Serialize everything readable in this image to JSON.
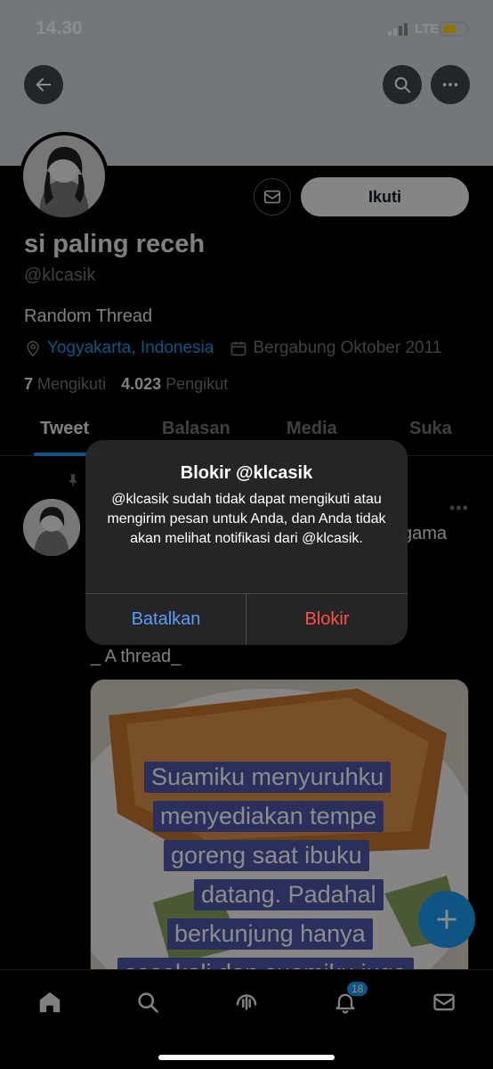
{
  "status_bar": {
    "time": "14.30",
    "network": "LTE"
  },
  "profile": {
    "name": "si paling receh",
    "handle": "@klcasik",
    "bio": "Random Thread",
    "location": "Yogyakarta, Indonesia",
    "joined": "Bergabung Oktober 2011",
    "following_count": "7",
    "following_label": "Mengikuti",
    "followers_count": "4.023",
    "followers_label": "Pengikut",
    "follow_button": "Ikuti"
  },
  "tabs": [
    {
      "label": "Tweet",
      "active": true
    },
    {
      "label": "Balasan"
    },
    {
      "label": "Media"
    },
    {
      "label": "Suka"
    }
  ],
  "post": {
    "peek_text": "gama",
    "text": "_ A thread_",
    "image_caption_lines": [
      "Suamiku menyuruhku",
      "menyediakan tempe",
      "goreng saat ibuku",
      "datang. Padahal",
      "berkunjung hanya",
      "sesekali dan suamiku juga"
    ]
  },
  "nav": {
    "notification_count": "18"
  },
  "dialog": {
    "title": "Blokir @klcasik",
    "message": "@klcasik sudah tidak dapat mengikuti atau mengirim pesan untuk Anda, dan Anda tidak akan melihat notifikasi dari @klcasik.",
    "cancel_label": "Batalkan",
    "confirm_label": "Blokir"
  },
  "colors": {
    "accent": "#1d9bf0",
    "destructive": "#ff5147",
    "dialog_button": "#5e9cf7"
  }
}
